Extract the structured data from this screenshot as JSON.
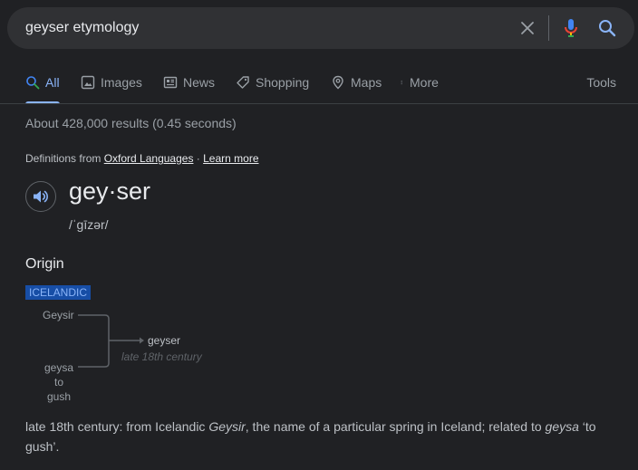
{
  "search": {
    "query": "geyser etymology"
  },
  "tabs": [
    {
      "label": "All"
    },
    {
      "label": "Images"
    },
    {
      "label": "News"
    },
    {
      "label": "Shopping"
    },
    {
      "label": "Maps"
    },
    {
      "label": "More"
    },
    {
      "label": "Tools"
    }
  ],
  "result_stats": "About 428,000 results (0.45 seconds)",
  "definitions": {
    "prefix": "Definitions from ",
    "source": "Oxford Languages",
    "separator": " · ",
    "learn_more": "Learn more"
  },
  "entry": {
    "headword": "gey·ser",
    "pronunciation": "/ˈɡīzər/",
    "origin_heading": "Origin",
    "language_badge": "ICELANDIC",
    "etymology": {
      "source_1": "Geysir",
      "source_2_line1": "geysa",
      "source_2_line2": "to",
      "source_2_line3": "gush",
      "result_word": "geyser",
      "result_period": "late 18th century"
    },
    "origin_text": {
      "part1": "late 18th century: from Icelandic ",
      "term1": "Geysir",
      "part2": ", the name of a particular spring in Iceland; related to ",
      "term2": "geysa",
      "part3": " ‘to gush’."
    }
  },
  "colors": {
    "background": "#202124",
    "accent": "#8ab4f8",
    "badge_bg": "#174ea6"
  },
  "icons": {
    "clear": "close-icon",
    "voice": "mic-icon",
    "search": "search-icon",
    "audio": "speaker-icon"
  }
}
